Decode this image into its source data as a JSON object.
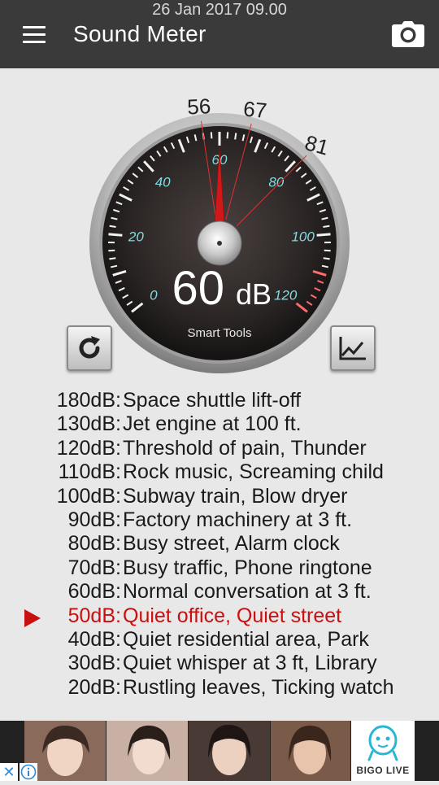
{
  "status": {
    "timestamp": "26 Jan 2017 09.00"
  },
  "app": {
    "title": "Sound Meter"
  },
  "gauge": {
    "current_db": 60,
    "value_text": "60",
    "unit": "dB",
    "brand": "Smart Tools",
    "scale_labels": [
      "0",
      "20",
      "40",
      "60",
      "80",
      "100",
      "120"
    ],
    "markers": [
      {
        "value": 56,
        "label": "56"
      },
      {
        "value": 67,
        "label": "67"
      },
      {
        "value": 81,
        "label": "81"
      }
    ],
    "colors": {
      "needle": "#d01818",
      "scale_numbers": "#7fdce0",
      "marker_lines": "#e03030"
    }
  },
  "reference": [
    {
      "db": "180dB",
      "desc": "Space shuttle lift-off"
    },
    {
      "db": "130dB",
      "desc": "Jet engine at 100 ft."
    },
    {
      "db": "120dB",
      "desc": "Threshold of pain, Thunder"
    },
    {
      "db": "110dB",
      "desc": "Rock music, Screaming child"
    },
    {
      "db": "100dB",
      "desc": "Subway train, Blow dryer"
    },
    {
      "db": "90dB",
      "desc": "Factory machinery at 3 ft."
    },
    {
      "db": "80dB",
      "desc": "Busy street, Alarm clock"
    },
    {
      "db": "70dB",
      "desc": "Busy traffic, Phone ringtone"
    },
    {
      "db": "60dB",
      "desc": "Normal conversation at 3 ft."
    },
    {
      "db": "50dB",
      "desc": "Quiet office, Quiet street",
      "active": true
    },
    {
      "db": "40dB",
      "desc": "Quiet residential area, Park"
    },
    {
      "db": "30dB",
      "desc": "Quiet whisper at 3 ft, Library"
    },
    {
      "db": "20dB",
      "desc": "Rustling leaves, Ticking watch"
    }
  ],
  "ad": {
    "brand": "BIGO LIVE",
    "close_glyph": "✕",
    "icons": [
      "close-icon",
      "info-icon",
      "bigo-live-logo"
    ]
  },
  "icons": {
    "menu": "hamburger-menu-icon",
    "camera": "camera-icon",
    "refresh": "refresh-icon",
    "chart": "line-chart-icon"
  }
}
